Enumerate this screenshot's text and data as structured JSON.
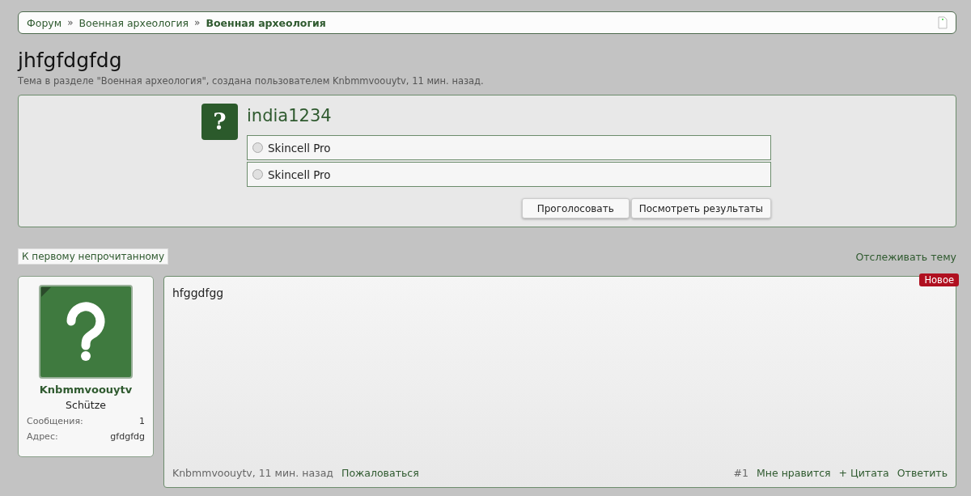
{
  "breadcrumbs": [
    {
      "label": "Форум",
      "current": false
    },
    {
      "label": "Военная археология",
      "current": false
    },
    {
      "label": "Военная археология",
      "current": true
    }
  ],
  "breadcrumb_separator": "»",
  "thread": {
    "title": "jhfgfdgfdg",
    "subtitle": "Тема в разделе \"Военная археология\", создана пользователем Knbmmvoouytv, 11 мин. назад."
  },
  "poll": {
    "icon_text": "?",
    "question": "india1234",
    "options": [
      {
        "label": "Skincell Pro",
        "selected": false
      },
      {
        "label": "Skincell Pro",
        "selected": false
      }
    ],
    "buttons": [
      "Проголосовать",
      "Посмотреть результаты"
    ]
  },
  "first_unread": "К первому непрочитанному",
  "watch_thread": "Отслеживать тему",
  "post": {
    "author": "Knbmmvoouytv",
    "rank": "Schütze",
    "stats": [
      {
        "label": "Сообщения:",
        "value": "1"
      },
      {
        "label": "Адрес:",
        "value": "gfdgfdg"
      }
    ],
    "badge": "Новое",
    "message": "hfggdfgg",
    "meta": "Knbmmvoouytv, 11 мин. назад",
    "report": "Пожаловаться",
    "number": "#1",
    "actions": [
      "Мне нравится",
      "+ Цитата",
      "Ответить"
    ]
  }
}
